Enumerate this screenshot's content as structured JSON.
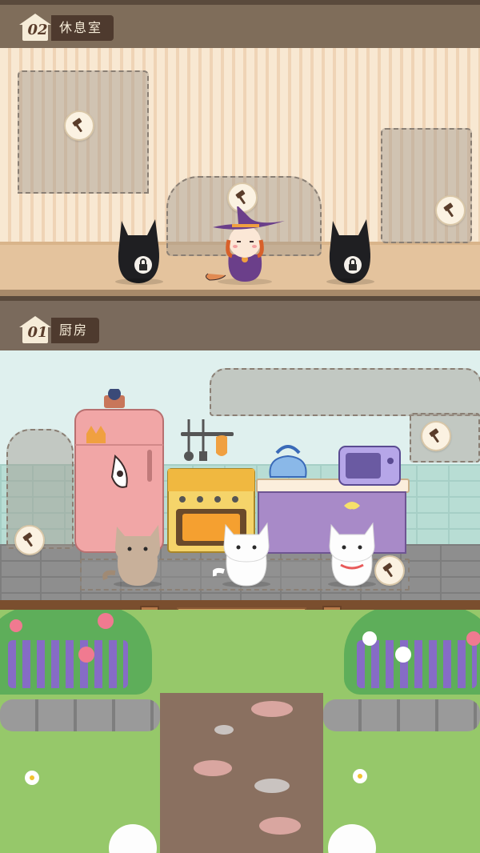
{
  "rooms": [
    {
      "id": "lounge",
      "number": "02",
      "name": "休息室"
    },
    {
      "id": "kitchen",
      "number": "01",
      "name": "厨房"
    }
  ],
  "icons": {
    "build": "hammer-icon",
    "locked": "lock-icon"
  },
  "colors": {
    "plaque_dark": "#4e3a2e",
    "plaque_light": "#f6ecd8",
    "lounge_wall": "#f6e2c8",
    "lounge_floor": "#e0bd94",
    "kitchen_wall": "#dcecea",
    "kitchen_floor": "#8b8b8b",
    "garden_green": "#8cc25a"
  }
}
